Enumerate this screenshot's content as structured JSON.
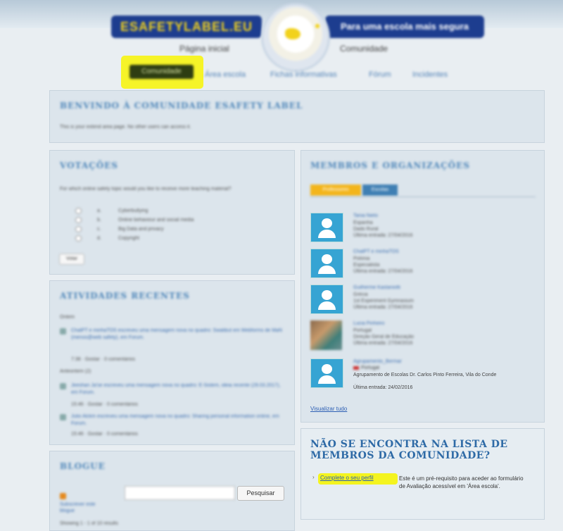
{
  "header": {
    "logo_left": "ESAFETYLABEL.EU",
    "logo_right": "Para uma escola mais segura",
    "subnav_home": "Página inicial",
    "subnav_community": "Comunidade"
  },
  "nav": {
    "community": "Comunidade",
    "school_area": "Área escola",
    "fact_sheets": "Fichas informativas",
    "forum": "Fórum",
    "incidents": "Incidentes"
  },
  "welcome": {
    "title": "BENVINDO À COMUNIDADE ESAFETY LABEL",
    "text": "This is your extend area page. No other users can access it."
  },
  "polls": {
    "title": "VOTAÇÕES",
    "question": "For which online safety topic would you like to receive more teaching material?",
    "options": [
      "a.",
      "b.",
      "c.",
      "d."
    ],
    "option_labels": [
      "Cyberbullying",
      "Online behaviour and social media",
      "Big Data and privacy",
      "Copyright"
    ],
    "vote_label": "Votar"
  },
  "activity": {
    "title": "ATIVIDADES RECENTES",
    "today_label": "Ontem",
    "today_text": "ChatPT e minhaTOS escreveu uma mensagem nova no quadro: Swalibut em Webforms de MaN (menos@web safety), em Forum.",
    "today_meta": "7:38 · Gostar · 0 comentários",
    "earlier_label": "Anteontem (2)",
    "earlier_1": "Jeeshan Ja'se escreveu uma mensagem nova no quadro: E-Sistem, ideia recente (29.03.2017), em Forum.",
    "earlier_1_meta": "15:46 · Gostar · 0 comentários",
    "earlier_2": "Julio Alckm escreveu uma mensagem nova no quadro: Sharing personal information online, em Forum.",
    "earlier_2_meta": "15:46 · Gostar · 0 comentários"
  },
  "blog": {
    "title": "BLOGUE",
    "rss_text": "Subscrever este blogue",
    "search_button": "Pesquisar",
    "showing": "Showing 1 - 1 of 10 results"
  },
  "members": {
    "title": "MEMBROS E ORGANIZAÇÕES",
    "tab_members": "Professores",
    "tab_orgs": "Escolas",
    "list": [
      {
        "name": "Tania Nieto",
        "country": "Espanha",
        "role": "Dado Rural",
        "last": "Última entrada: 27/04/2016"
      },
      {
        "name": "ChatPT e minhaTOS",
        "country": "Polónia",
        "role": "Especialista",
        "last": "Última entrada: 27/04/2016"
      },
      {
        "name": "Guilherme Kastaniotti",
        "country": "Grécia",
        "role": "1st Experiment Gymnasium",
        "last": "Última entrada: 27/04/2016"
      },
      {
        "name": "Lucia Pinheiro",
        "country": "Portugal",
        "role": "Direção Geral de Educação",
        "last": "Última entrada: 27/04/2016"
      },
      {
        "name": "Agrupamento_Bermar",
        "country": "Portugal",
        "role": "Agrupamento de Escolas Dr. Carlos Pinto Ferreira, Vila do Conde",
        "last": "Última entrada: 24/02/2016"
      }
    ],
    "view_all": "Visualizar tudo"
  },
  "not_found": {
    "title": "NÃO SE ENCONTRA NA LISTA DE MEMBROS DA COMUNIDADE?",
    "link": "Complete o seu perfil",
    "text": "Este é um pré-requisito para aceder ao formulário de Avaliação acessível em 'Área escola'."
  },
  "colors": {
    "accent": "#4e86b9",
    "brand": "#1d3d8f",
    "highlight": "#f6f428",
    "avatar": "#36a4d3"
  }
}
